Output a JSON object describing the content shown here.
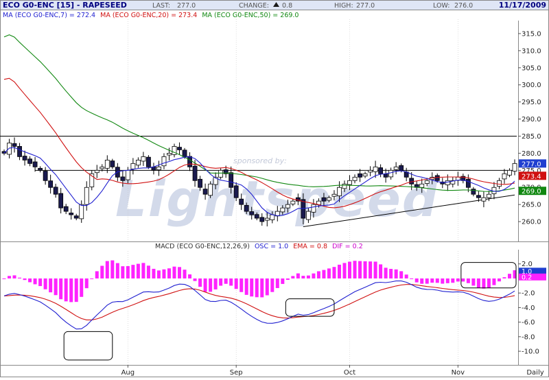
{
  "header": {
    "symbol": "ECO G0-ENC [15] - RAPESEED",
    "last_label": "LAST:",
    "last_value": "277.0",
    "change_label": "CHANGE:",
    "change_value": "0.8",
    "high_label": "HIGH:",
    "high_value": "277.0",
    "low_label": "LOW:",
    "low_value": "276.0",
    "date": "11/17/2009"
  },
  "ma_legend": [
    {
      "text": "MA (ECO G0-ENC,7) = 272.4",
      "color": "#1f1fd0"
    },
    {
      "text": "MA (ECO G0-ENC,20) = 273.4",
      "color": "#d01010"
    },
    {
      "text": "MA (ECO G0-ENC,50) = 269.0",
      "color": "#118811"
    }
  ],
  "macd_legend": [
    {
      "text": "MACD (ECO G0-ENC,12,26,9)",
      "color": "#303030"
    },
    {
      "text": "OSC = 1.0",
      "color": "#1f1fd0"
    },
    {
      "text": "EMA = 0.8",
      "color": "#d01010"
    },
    {
      "text": "DIF = 0.2",
      "color": "#cc00cc"
    }
  ],
  "watermark": {
    "sponsor": "sponsored by:",
    "brand": "Lightspeed"
  },
  "colors": {
    "bull_body": "#ffffff",
    "bear_body": "#1a1a4e",
    "ma7": "#1f1fd0",
    "ma20": "#d01010",
    "ma50": "#118811",
    "macd_osc": "#1f1fd0",
    "macd_ema": "#d01010",
    "macd_hist": "#ff22ff",
    "header_text": "#000080",
    "grid": "#c8c8c8"
  },
  "x_axis": {
    "labels": [
      "Aug",
      "Sep",
      "Oct",
      "Nov"
    ],
    "period": "Daily"
  },
  "price_badges": [
    {
      "text": "277.0",
      "value": 277.0,
      "bg": "#1f3fd0"
    },
    {
      "text": "273.4",
      "value": 273.4,
      "bg": "#d01010"
    },
    {
      "text": "269.0",
      "value": 269.0,
      "bg": "#118811"
    }
  ],
  "macd_badges": [
    {
      "text": "1.0",
      "value": 1.0,
      "bg": "#1f3fd0"
    },
    {
      "text": "0.2",
      "value": 0.2,
      "bg": "#ff22ff"
    }
  ],
  "chart_data": [
    {
      "type": "candlestick",
      "title": "ECO G0-ENC [15] - RAPESEED",
      "ylim": [
        255,
        318
      ],
      "yticks": [
        260.0,
        265.0,
        270.0,
        275.0,
        280.0,
        285.0,
        290.0,
        295.0,
        300.0,
        305.0,
        310.0,
        315.0
      ],
      "ytick_labels": [
        "260.0",
        "265.0",
        "270.0",
        "275.0",
        "280.0",
        "285.0",
        "290.0",
        "295.0",
        "300.0",
        "305.0",
        "310.0",
        "315.0"
      ],
      "num_bars": 100,
      "month_starts": {
        "Aug": 24,
        "Sep": 45,
        "Oct": 67,
        "Nov": 88
      },
      "horizontal_lines": [
        285.0,
        275.0
      ],
      "trendline": {
        "from": [
          58,
          258.5
        ],
        "to": [
          99,
          267.8
        ]
      },
      "closes": [
        280,
        283,
        282,
        279,
        278,
        277,
        276,
        275,
        272,
        270,
        268,
        264,
        263,
        262,
        261,
        265,
        270,
        274,
        275,
        276,
        278,
        276,
        273,
        272,
        275,
        277,
        278,
        279,
        276,
        275,
        276,
        279,
        280,
        282,
        281,
        279,
        276,
        272,
        270,
        268,
        271,
        273,
        275,
        274,
        270,
        267,
        265,
        263,
        262,
        261,
        260,
        261,
        262,
        263,
        264,
        265,
        266,
        266,
        261,
        263,
        265,
        266,
        266,
        267,
        268,
        270,
        271,
        272,
        273,
        273,
        274,
        275,
        276,
        274,
        273,
        275,
        276,
        275,
        273,
        271,
        270,
        271,
        272,
        273,
        272,
        271,
        272,
        272,
        273,
        272,
        270,
        268,
        267,
        267,
        268,
        270,
        272,
        274,
        275,
        277
      ],
      "series": [
        {
          "name": "MA (ECO G0-ENC,7)",
          "last": 272.4
        },
        {
          "name": "MA (ECO G0-ENC,20)",
          "last": 273.4
        },
        {
          "name": "MA (ECO G0-ENC,50)",
          "last": 269.0
        }
      ]
    },
    {
      "type": "line+bar",
      "title": "MACD (ECO G0-ENC,12,26,9)",
      "ylim": [
        -11.5,
        3.2
      ],
      "yticks": [
        2.0,
        -2.0,
        -4.0,
        -6.0,
        -8.0,
        -10.0
      ],
      "ytick_labels": [
        "2.0",
        "-2.0",
        "-4.0",
        "-6.0",
        "-8.0",
        "-10.0"
      ],
      "series": [
        {
          "name": "OSC",
          "last": 1.0
        },
        {
          "name": "EMA",
          "last": 0.8
        },
        {
          "name": "DIF",
          "last": 0.2
        }
      ],
      "highlight_boxes": [
        [
          12,
          21,
          -11.2,
          -7.3
        ],
        [
          55,
          64,
          -5.2,
          -2.8
        ],
        [
          89,
          100,
          2.2,
          -1.3
        ]
      ]
    }
  ]
}
